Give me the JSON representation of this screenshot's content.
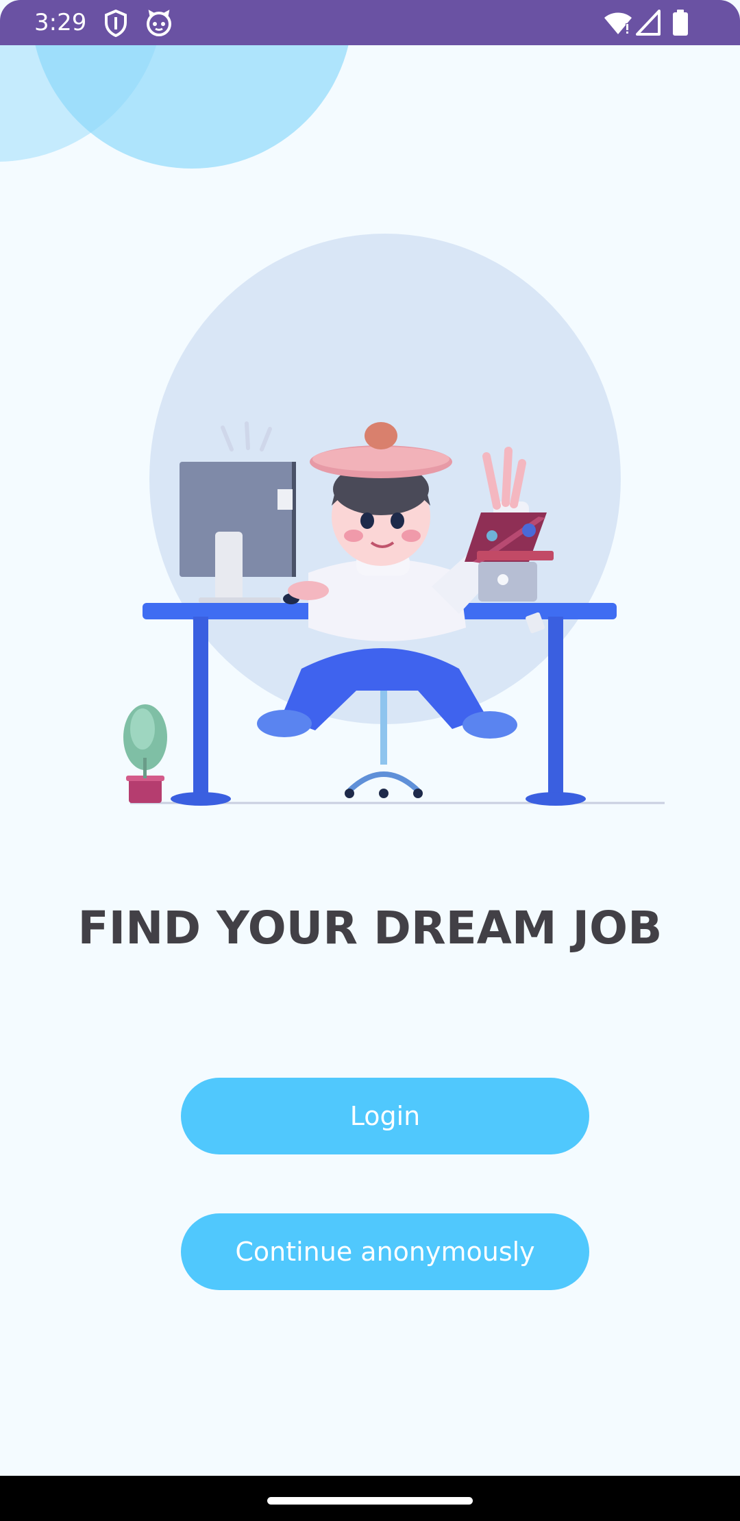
{
  "status_bar": {
    "time": "3:29",
    "icons": [
      "shield-icon",
      "cat-face-icon",
      "wifi-icon",
      "signal-icon",
      "battery-icon"
    ],
    "background": "#6a52a3"
  },
  "illustration": {
    "subject": "person at desk with monitor and laptop, waving"
  },
  "headline": "FIND YOUR DREAM JOB",
  "buttons": {
    "login_label": "Login",
    "anonymous_label": "Continue anonymously",
    "color": "#50c8fd"
  },
  "colors": {
    "background": "#f4fbff",
    "headline": "#424046",
    "accent_blue": "#3f6df2"
  }
}
